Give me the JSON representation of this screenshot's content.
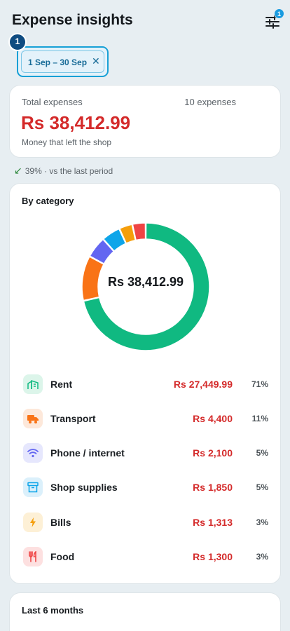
{
  "header": {
    "title": "Expense insights",
    "filter_badge": "1"
  },
  "filter_chip": {
    "label": "1 Sep – 30 Sep",
    "close": "✕",
    "step_number": "1"
  },
  "summary": {
    "label": "Total expenses",
    "count": "10 expenses",
    "amount": "Rs 38,412.99",
    "subtitle": "Money that left the shop"
  },
  "trend": {
    "icon": "arrow-down-left-icon",
    "text": "39% · vs the last period"
  },
  "by_category": {
    "heading": "By category",
    "center_label": "Rs 38,412.99",
    "items": [
      {
        "name": "Rent",
        "amount": "Rs 27,449.99",
        "pct": "71%",
        "value": 27449.99,
        "color": "#10b981",
        "bg": "#dcf5ea",
        "icon": "building-icon"
      },
      {
        "name": "Transport",
        "amount": "Rs 4,400",
        "pct": "11%",
        "value": 4400,
        "color": "#f97316",
        "bg": "#fde8da",
        "icon": "truck-icon"
      },
      {
        "name": "Phone / internet",
        "amount": "Rs 2,100",
        "pct": "5%",
        "value": 2100,
        "color": "#6366f1",
        "bg": "#e6e7fd",
        "icon": "wifi-icon"
      },
      {
        "name": "Shop supplies",
        "amount": "Rs 1,850",
        "pct": "5%",
        "value": 1850,
        "color": "#0ea5e9",
        "bg": "#dbf0fb",
        "icon": "archive-box-icon"
      },
      {
        "name": "Bills",
        "amount": "Rs 1,313",
        "pct": "3%",
        "value": 1313,
        "color": "#f59e0b",
        "bg": "#fdf0d6",
        "icon": "lightning-icon"
      },
      {
        "name": "Food",
        "amount": "Rs 1,300",
        "pct": "3%",
        "value": 1300,
        "color": "#ef4444",
        "bg": "#fde0e0",
        "icon": "fork-knife-icon"
      }
    ]
  },
  "last_months": {
    "heading": "Last 6 months"
  }
}
